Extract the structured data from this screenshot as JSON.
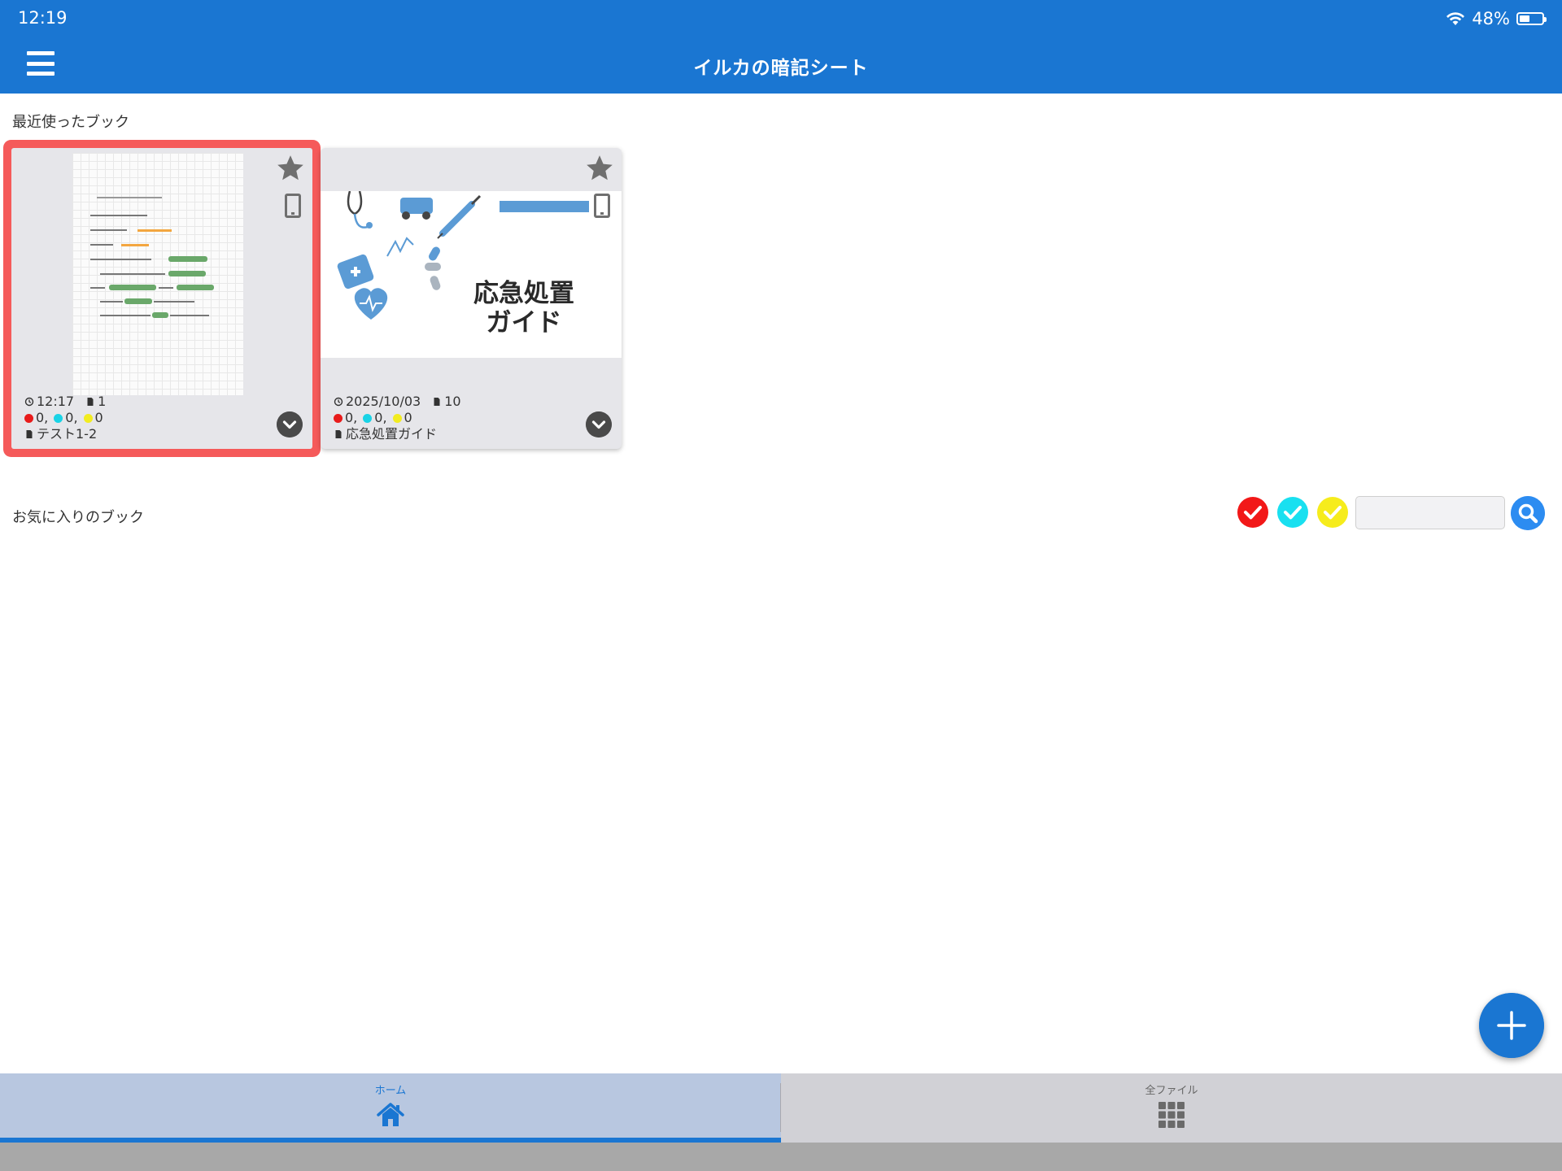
{
  "status_bar": {
    "time": "12:19",
    "battery_percent": "48%",
    "battery_level": 0.48
  },
  "header": {
    "title": "イルカの暗記シート",
    "menu_icon": "hamburger-menu-icon",
    "background": "#1a76d2"
  },
  "recent": {
    "label": "最近使ったブック",
    "books": [
      {
        "last_opened": "12:17",
        "pages": "1",
        "counts_text": "0, 0, 0",
        "red_count": "0,",
        "cyan_count": "0,",
        "yellow_count": "0",
        "name": "テスト1-2",
        "selected": true
      },
      {
        "last_opened": "2025/10/03",
        "pages": "10",
        "red_count": "0,",
        "cyan_count": "0,",
        "yellow_count": "0",
        "name": "応急処置ガイド",
        "thumbnail_title": "応急処置ガイド",
        "selected": false
      }
    ]
  },
  "favorites": {
    "label": "お気に入りのブック",
    "search_placeholder": "",
    "filters": [
      {
        "name": "red-check",
        "color": "#f21818"
      },
      {
        "name": "cyan-check",
        "color": "#19e0f0"
      },
      {
        "name": "yellow-check",
        "color": "#f6ec1c"
      }
    ]
  },
  "tabs": [
    {
      "label": "ホーム",
      "icon": "home-icon",
      "active": true
    },
    {
      "label": "全ファイル",
      "icon": "grid-icon",
      "active": false
    }
  ],
  "colors": {
    "accent": "#1a76d2",
    "selection": "#f55a5a",
    "card_bg": "#e6e6ea"
  }
}
